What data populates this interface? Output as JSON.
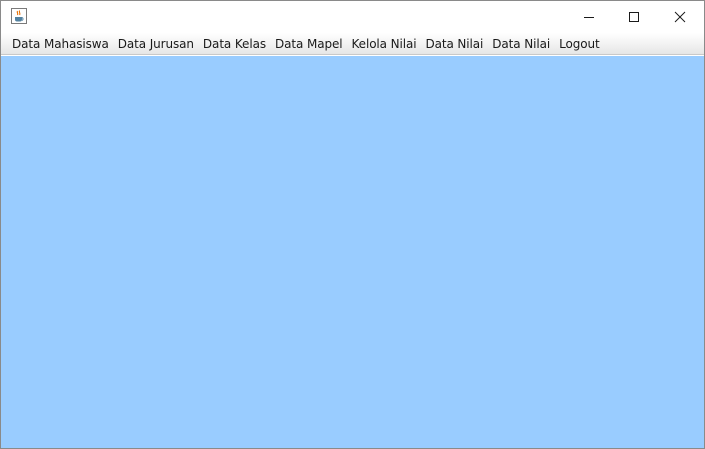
{
  "window": {
    "icon": "java-coffee-cup-icon",
    "controls": {
      "minimize": "minimize-icon",
      "maximize": "maximize-icon",
      "close": "close-icon"
    }
  },
  "menubar": {
    "items": [
      {
        "label": "Data Mahasiswa"
      },
      {
        "label": "Data Jurusan"
      },
      {
        "label": "Data Kelas"
      },
      {
        "label": "Data Mapel"
      },
      {
        "label": "Kelola Nilai"
      },
      {
        "label": "Data Nilai"
      },
      {
        "label": "Data Nilai"
      },
      {
        "label": "Logout"
      }
    ]
  },
  "content": {
    "background": "#99ccff"
  }
}
